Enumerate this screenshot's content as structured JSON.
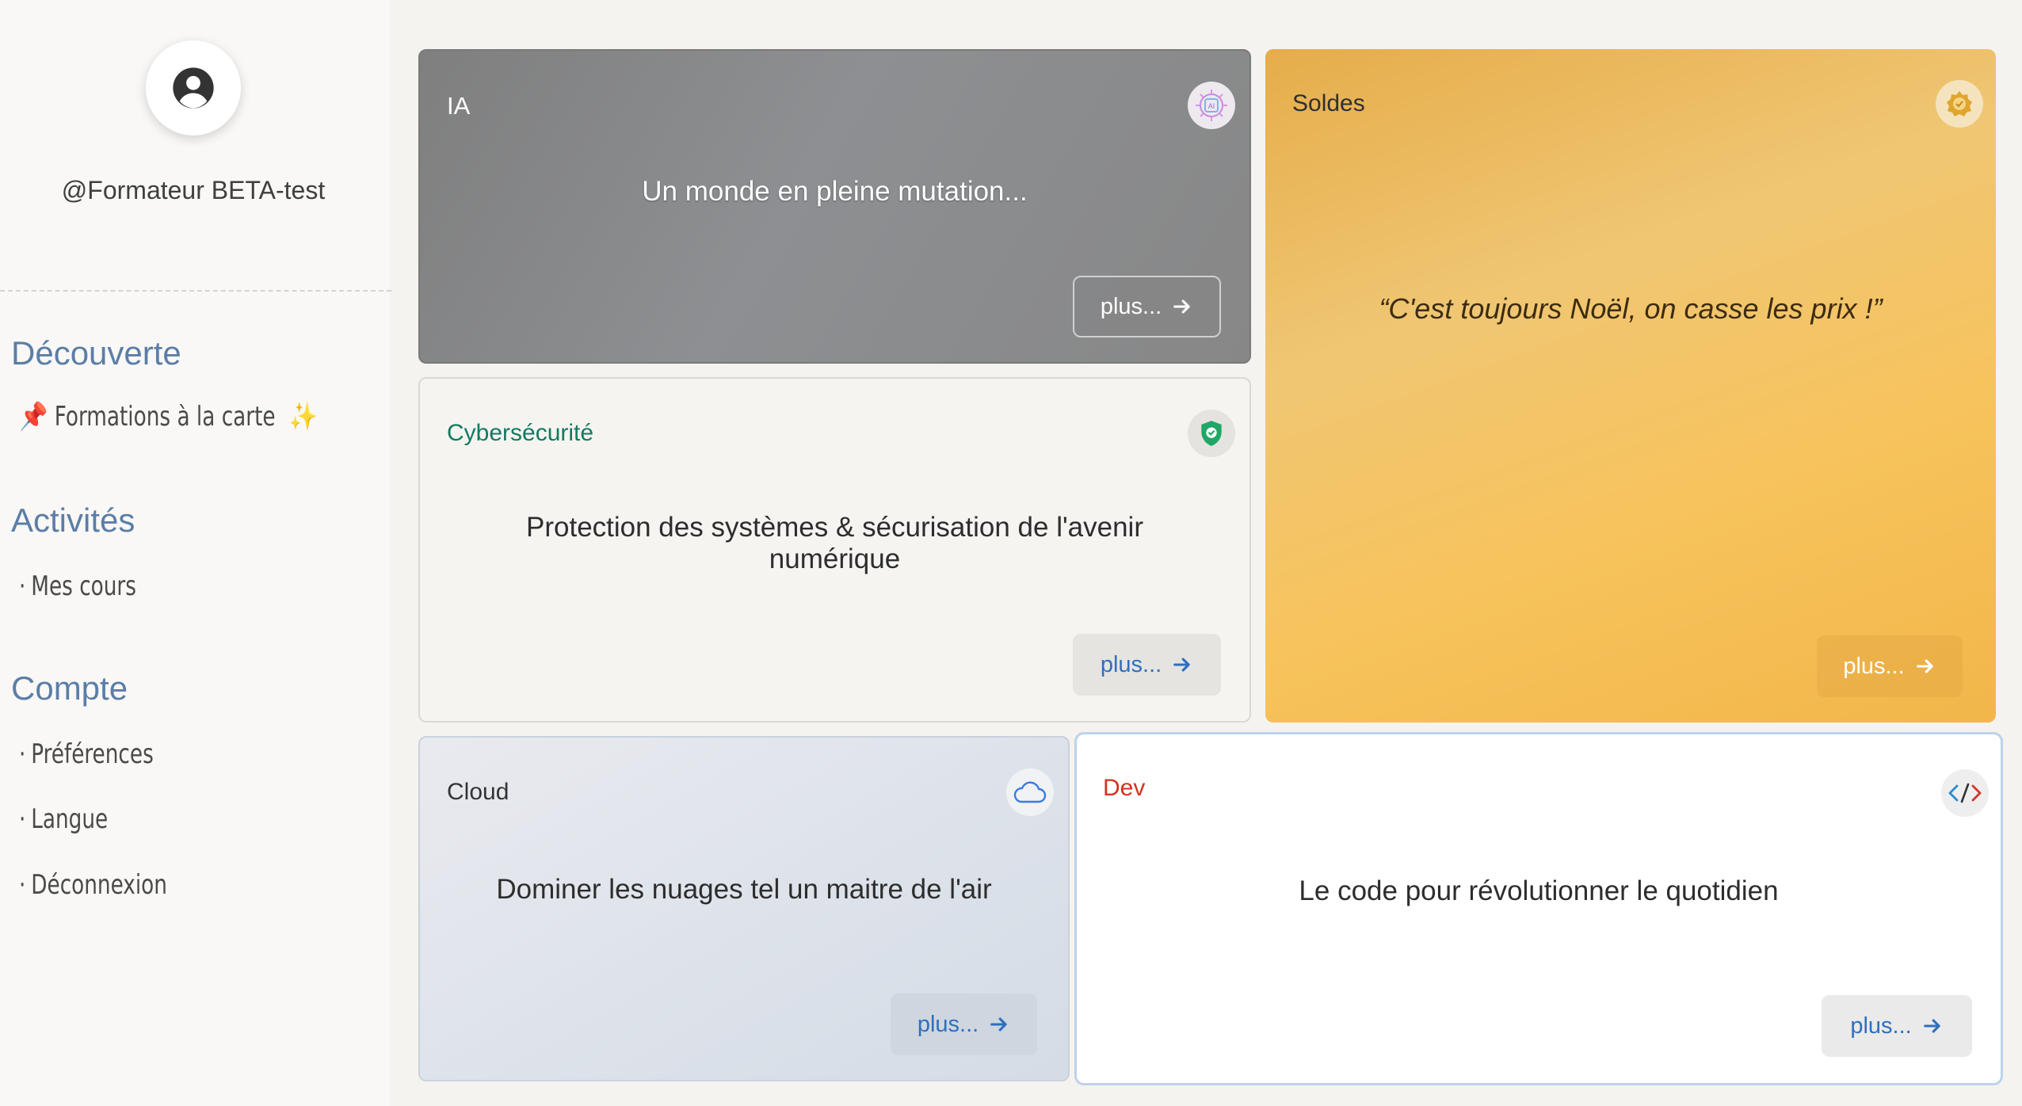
{
  "sidebar": {
    "username": "@Formateur BETA-test",
    "sections": [
      {
        "title": "Découverte",
        "items": [
          {
            "label": "Formations à la carte",
            "icon_before": "📌",
            "icon_after": "✨"
          }
        ]
      },
      {
        "title": "Activités",
        "items": [
          {
            "label": "Mes cours",
            "bullet": "·"
          }
        ]
      },
      {
        "title": "Compte",
        "items": [
          {
            "label": "Préférences",
            "bullet": "·"
          },
          {
            "label": "Langue",
            "bullet": "·"
          },
          {
            "label": "Déconnexion",
            "bullet": "·"
          }
        ]
      }
    ]
  },
  "cards": {
    "ia": {
      "label": "IA",
      "text": "Un monde en pleine mutation...",
      "button": "plus...",
      "icon": "ai-chip-icon",
      "label_color": "#ffffff"
    },
    "soldes": {
      "label": "Soldes",
      "text": "“C'est toujours Noël, on casse les prix !”",
      "button": "plus...",
      "icon": "sale-badge-icon",
      "accent": "#f2b64a"
    },
    "cyber": {
      "label": "Cybersécurité",
      "text": "Protection des systèmes & sécurisation de l'avenir numérique",
      "button": "plus...",
      "icon": "shield-check-icon",
      "label_color": "#137a62"
    },
    "cloud": {
      "label": "Cloud",
      "text": "Dominer les nuages tel un maitre de l'air",
      "button": "plus...",
      "icon": "cloud-icon"
    },
    "dev": {
      "label": "Dev",
      "text": "Le code pour révolutionner le quotidien",
      "button": "plus...",
      "icon": "code-icon",
      "label_color": "#d2331f"
    }
  },
  "colors": {
    "section_title": "#5b7ea7",
    "button_text": "#2f6fbd",
    "page_bg": "#f5f3ef"
  }
}
